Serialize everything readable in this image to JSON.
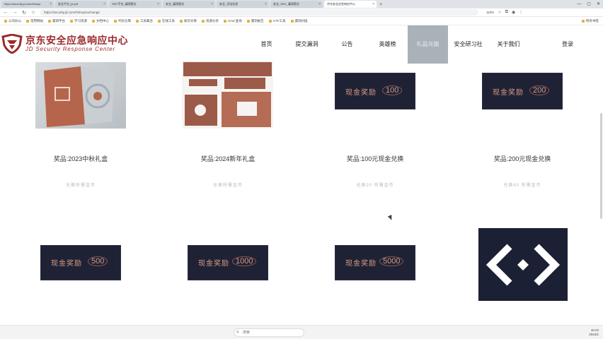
{
  "browser": {
    "tabs": [
      {
        "title": "https://security.jd.com/#/shop"
      },
      {
        "title": "安全平台_jd.pdf"
      },
      {
        "title": "SRC平台_漏洞提交"
      },
      {
        "title": "安全_漏洞提交"
      },
      {
        "title": "安全_活动信息"
      },
      {
        "title": "安全_SRC_漏洞提交"
      },
      {
        "title": "京东安全应急响应中心"
      }
    ],
    "new_tab": "+",
    "url": "https://security.jd.com/#/shop/exchange",
    "zoom": "110%",
    "bookmarks": [
      "公司办公",
      "常用网站",
      "漏洞平台",
      "学习资源",
      "文档中心",
      "代码仓库",
      "工具集合",
      "在线工具",
      "知识文章",
      "资源分享",
      "Cmd 查询",
      "漏洞报告",
      "CTF工具",
      "漏洞扫描"
    ],
    "bookmark_right": "所有书签",
    "window_controls": {
      "minimize": "—",
      "maximize": "▢",
      "close": "✕"
    }
  },
  "site": {
    "logo": {
      "cn": "京东安全应急响应中心",
      "en": "JD Security Response Center"
    },
    "nav": [
      {
        "label": "首页",
        "active": false
      },
      {
        "label": "提交漏洞",
        "active": false
      },
      {
        "label": "公告",
        "active": false
      },
      {
        "label": "英雄榜",
        "active": false
      },
      {
        "label": "礼品兑换",
        "active": true
      },
      {
        "label": "安全研习社",
        "active": false
      },
      {
        "label": "关于我们",
        "active": false
      }
    ],
    "login": "登录"
  },
  "gifts": [
    {
      "name": "奖品:2023中秋礼盒",
      "cost": "兑换所需金币"
    },
    {
      "name": "奖品:2024新年礼盒",
      "cost": "兑换所需金币"
    },
    {
      "name": "奖品:100元现金兑换",
      "cost": "兑换20 所需金币",
      "card_text": "现金奖励",
      "amount": "100"
    },
    {
      "name": "奖品:200元现金兑换",
      "cost": "兑换40 所需金币",
      "card_text": "现金奖励",
      "amount": "200"
    }
  ],
  "gifts_row2": [
    {
      "card_text": "现金奖励",
      "amount": "500"
    },
    {
      "card_text": "现金奖励",
      "amount": "1000"
    },
    {
      "card_text": "现金奖励",
      "amount": "5000"
    },
    {
      "logo": "jd-security-logo"
    }
  ],
  "taskbar": {
    "search_placeholder": "搜索",
    "time": "16:22",
    "date": "2024/1"
  },
  "colors": {
    "brand": "#9b2a2a",
    "card_bg": "#1f2235",
    "card_text": "#d79b84",
    "active_nav": "#a9b2b8"
  }
}
